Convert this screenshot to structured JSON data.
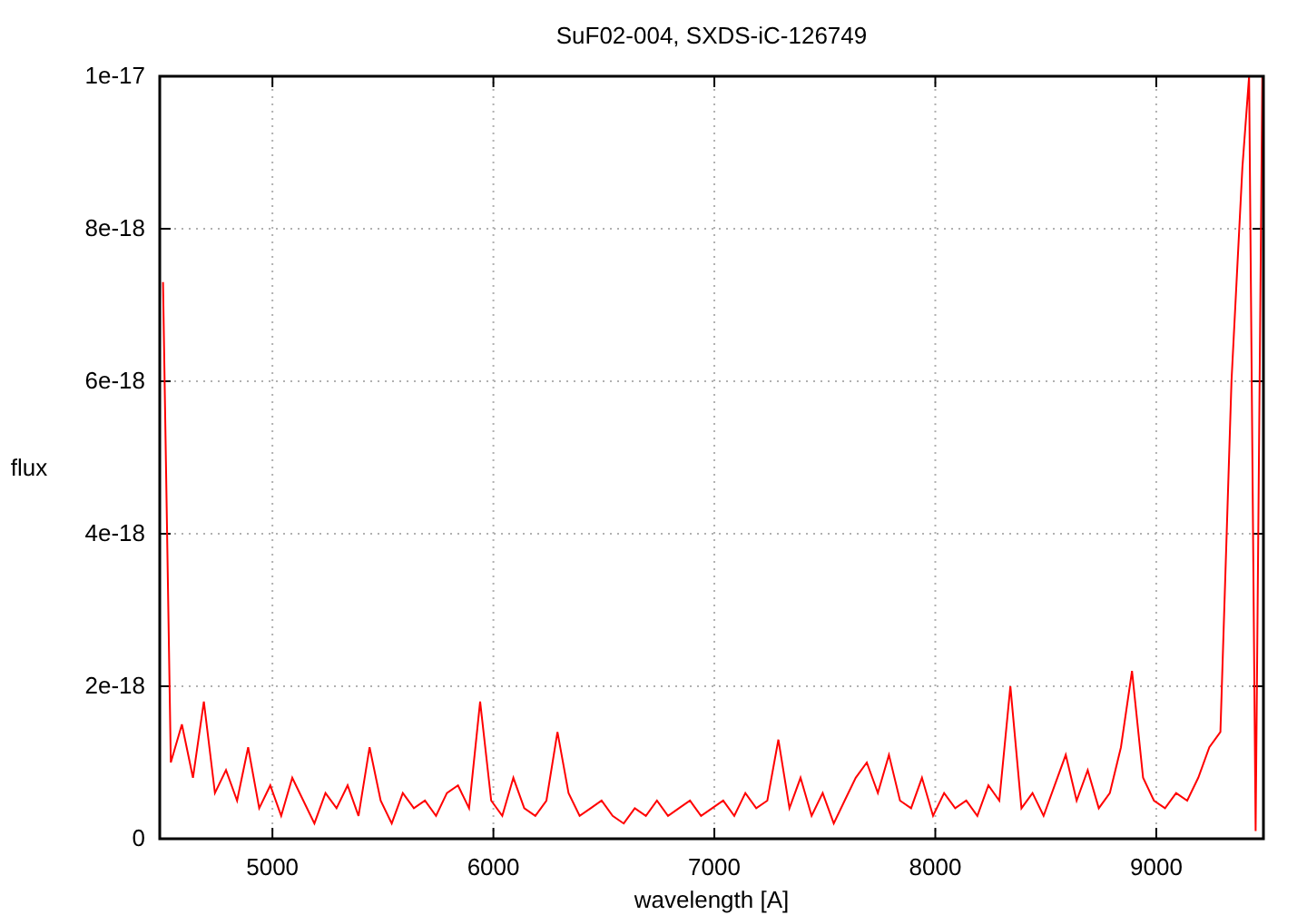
{
  "chart_data": {
    "type": "line",
    "title": "SuF02-004, SXDS-iC-126749",
    "xlabel": "wavelength [A]",
    "ylabel": "flux",
    "x": [
      4505,
      4540,
      4590,
      4640,
      4690,
      4740,
      4790,
      4840,
      4890,
      4940,
      4990,
      5040,
      5090,
      5140,
      5190,
      5240,
      5290,
      5340,
      5390,
      5440,
      5490,
      5540,
      5590,
      5640,
      5690,
      5740,
      5790,
      5840,
      5890,
      5940,
      5990,
      6040,
      6090,
      6140,
      6190,
      6240,
      6290,
      6340,
      6390,
      6440,
      6490,
      6540,
      6590,
      6640,
      6690,
      6740,
      6790,
      6840,
      6890,
      6940,
      6990,
      7040,
      7090,
      7140,
      7190,
      7240,
      7290,
      7340,
      7390,
      7440,
      7490,
      7540,
      7590,
      7640,
      7690,
      7740,
      7790,
      7840,
      7890,
      7940,
      7990,
      8040,
      8090,
      8140,
      8190,
      8240,
      8290,
      8340,
      8390,
      8440,
      8490,
      8540,
      8590,
      8640,
      8690,
      8740,
      8790,
      8840,
      8890,
      8940,
      8990,
      9040,
      9090,
      9140,
      9190,
      9240,
      9290,
      9340,
      9390,
      9420,
      9450,
      9480
    ],
    "grid": true,
    "series": [
      {
        "color": "#ff0000",
        "values": [
          7.3e-18,
          1e-18,
          1.5e-18,
          8e-19,
          1.8e-18,
          6e-19,
          9e-19,
          5e-19,
          1.2e-18,
          4e-19,
          7e-19,
          3e-19,
          8e-19,
          5e-19,
          2e-19,
          6e-19,
          4e-19,
          7e-19,
          3e-19,
          1.2e-18,
          5e-19,
          2e-19,
          6e-19,
          4e-19,
          5e-19,
          3e-19,
          6e-19,
          7e-19,
          4e-19,
          1.8e-18,
          5e-19,
          3e-19,
          8e-19,
          4e-19,
          3e-19,
          5e-19,
          1.4e-18,
          6e-19,
          3e-19,
          4e-19,
          5e-19,
          3e-19,
          2e-19,
          4e-19,
          3e-19,
          5e-19,
          3e-19,
          4e-19,
          5e-19,
          3e-19,
          4e-19,
          5e-19,
          3e-19,
          6e-19,
          4e-19,
          5e-19,
          1.3e-18,
          4e-19,
          8e-19,
          3e-19,
          6e-19,
          2e-19,
          5e-19,
          8e-19,
          1e-18,
          6e-19,
          1.1e-18,
          5e-19,
          4e-19,
          8e-19,
          3e-19,
          6e-19,
          4e-19,
          5e-19,
          3e-19,
          7e-19,
          5e-19,
          2e-18,
          4e-19,
          6e-19,
          3e-19,
          7e-19,
          1.1e-18,
          5e-19,
          9e-19,
          4e-19,
          6e-19,
          1.2e-18,
          2.2e-18,
          8e-19,
          5e-19,
          4e-19,
          6e-19,
          5e-19,
          8e-19,
          1.2e-18,
          1.4e-18,
          6e-18,
          8.8e-18,
          1e-17,
          1e-19,
          1e-17
        ]
      }
    ],
    "xlim": [
      4490,
      9485
    ],
    "ylim": [
      0,
      1e-17
    ],
    "xticks": [
      5000,
      6000,
      7000,
      8000,
      9000
    ],
    "yticks": [
      {
        "value": 0,
        "label": "0"
      },
      {
        "value": 2e-18,
        "label": "2e-18"
      },
      {
        "value": 4e-18,
        "label": "4e-18"
      },
      {
        "value": 6e-18,
        "label": "6e-18"
      },
      {
        "value": 8e-18,
        "label": "8e-18"
      },
      {
        "value": 1e-17,
        "label": "1e-17"
      }
    ]
  }
}
